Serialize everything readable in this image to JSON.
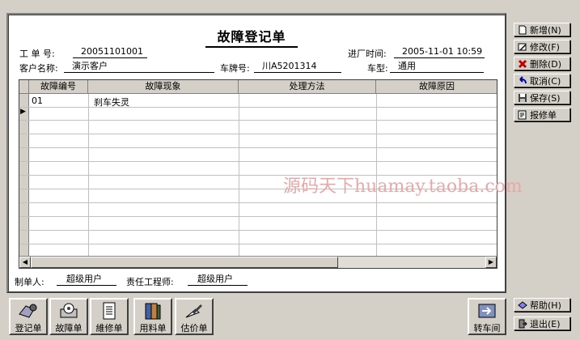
{
  "form": {
    "title": "故障登记单",
    "work_no_label": "工 单 号:",
    "work_no": "20051101001",
    "entry_time_label": "进厂时间:",
    "entry_time": "2005-11-01 10:59",
    "customer_label": "客户名称:",
    "customer": "演示客户",
    "plate_label": "车牌号:",
    "plate": "川A5201314",
    "model_label": "车型:",
    "model": "通用",
    "creator_label": "制单人:",
    "creator": "超级用户",
    "engineer_label": "责任工程师:",
    "engineer": "超级用户"
  },
  "grid": {
    "columns": [
      "故障编号",
      "故障现象",
      "处理方法",
      "故障原因"
    ],
    "rows": [
      {
        "code": "01",
        "symptom": "刹车失灵",
        "method": "",
        "cause": ""
      }
    ],
    "current_row_marker": "▶"
  },
  "watermark": "源码天下huamay.taoba.com",
  "side_buttons": {
    "new": "新增(N)",
    "edit": "修改(F)",
    "delete": "删除(D)",
    "cancel": "取消(C)",
    "save": "保存(S)",
    "repair_order": "报修单",
    "help": "帮助(H)",
    "exit": "退出(E)"
  },
  "bottom_buttons": {
    "register": "登记单",
    "fault": "故障单",
    "repair": "維修单",
    "material": "用料单",
    "estimate": "估价单",
    "transfer": "转车间"
  },
  "colors": {
    "background": "#d4d0c8",
    "panel": "#ffffff",
    "watermark": "#e8a8a8"
  }
}
